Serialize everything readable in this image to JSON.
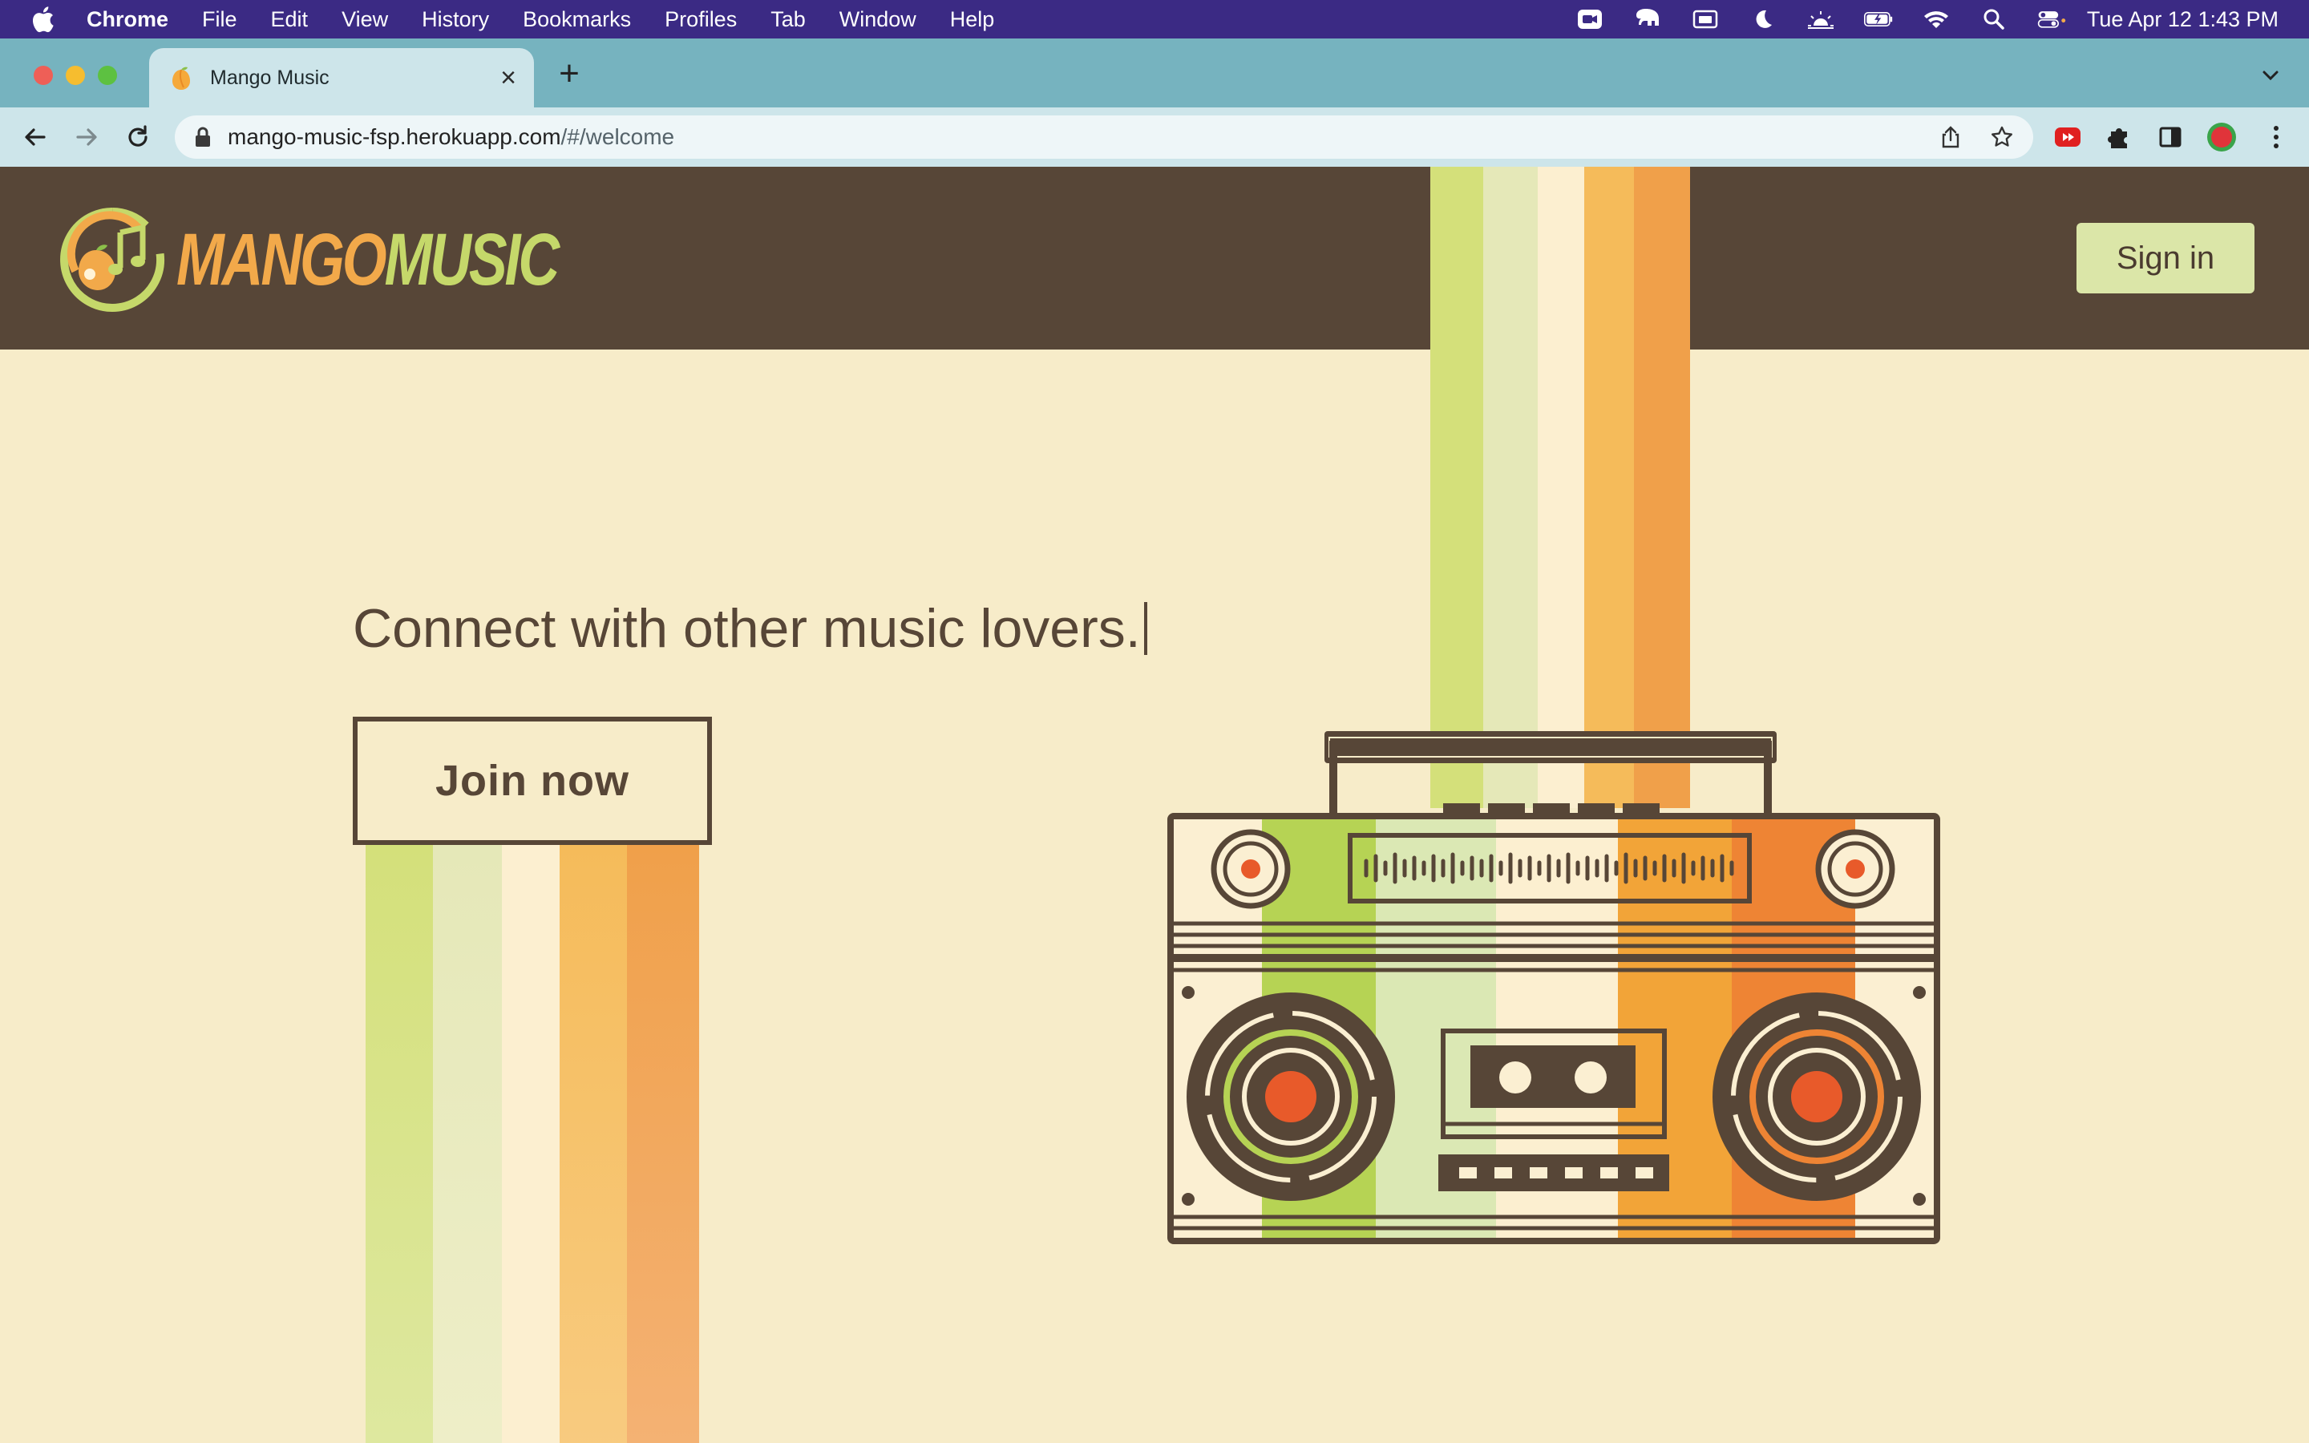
{
  "menubar": {
    "app_name": "Chrome",
    "items": [
      "File",
      "Edit",
      "View",
      "History",
      "Bookmarks",
      "Profiles",
      "Tab",
      "Window",
      "Help"
    ],
    "clock": "Tue Apr 12  1:43 PM",
    "status_icons": [
      "zoom-icon",
      "elephant-icon",
      "screen-mirror-icon",
      "moon-icon",
      "brightness-icon",
      "battery-icon",
      "wifi-icon",
      "spotlight-icon",
      "control-center-icon"
    ]
  },
  "browser": {
    "tab_title": "Mango Music",
    "url_host": "mango-music-fsp.herokuapp.com",
    "url_path": "/#/welcome"
  },
  "site": {
    "logo_word1": "MANGO",
    "logo_word2": "MUSIC",
    "signin_label": "Sign in",
    "headline": "Connect with other music lovers.",
    "join_label": "Join now"
  },
  "colors": {
    "header_brown": "#574637",
    "page_cream": "#f7ecc9",
    "stripe_colors": [
      "#d4e07a",
      "#e5e8b8",
      "#fcefd0",
      "#f5bb5a",
      "#f0a04a"
    ],
    "accent_orange": "#e85a2a",
    "signin_bg": "#dbe6a8"
  }
}
